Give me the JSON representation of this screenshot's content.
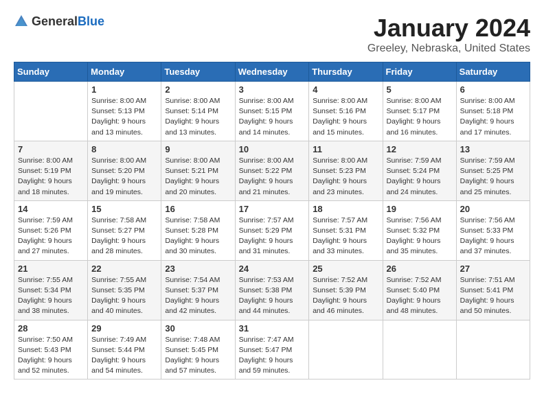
{
  "logo": {
    "general": "General",
    "blue": "Blue"
  },
  "title": "January 2024",
  "location": "Greeley, Nebraska, United States",
  "days_header": [
    "Sunday",
    "Monday",
    "Tuesday",
    "Wednesday",
    "Thursday",
    "Friday",
    "Saturday"
  ],
  "weeks": [
    [
      {
        "day": "",
        "sunrise": "",
        "sunset": "",
        "daylight": ""
      },
      {
        "day": "1",
        "sunrise": "Sunrise: 8:00 AM",
        "sunset": "Sunset: 5:13 PM",
        "daylight": "Daylight: 9 hours and 13 minutes."
      },
      {
        "day": "2",
        "sunrise": "Sunrise: 8:00 AM",
        "sunset": "Sunset: 5:14 PM",
        "daylight": "Daylight: 9 hours and 13 minutes."
      },
      {
        "day": "3",
        "sunrise": "Sunrise: 8:00 AM",
        "sunset": "Sunset: 5:15 PM",
        "daylight": "Daylight: 9 hours and 14 minutes."
      },
      {
        "day": "4",
        "sunrise": "Sunrise: 8:00 AM",
        "sunset": "Sunset: 5:16 PM",
        "daylight": "Daylight: 9 hours and 15 minutes."
      },
      {
        "day": "5",
        "sunrise": "Sunrise: 8:00 AM",
        "sunset": "Sunset: 5:17 PM",
        "daylight": "Daylight: 9 hours and 16 minutes."
      },
      {
        "day": "6",
        "sunrise": "Sunrise: 8:00 AM",
        "sunset": "Sunset: 5:18 PM",
        "daylight": "Daylight: 9 hours and 17 minutes."
      }
    ],
    [
      {
        "day": "7",
        "sunrise": "Sunrise: 8:00 AM",
        "sunset": "Sunset: 5:19 PM",
        "daylight": "Daylight: 9 hours and 18 minutes."
      },
      {
        "day": "8",
        "sunrise": "Sunrise: 8:00 AM",
        "sunset": "Sunset: 5:20 PM",
        "daylight": "Daylight: 9 hours and 19 minutes."
      },
      {
        "day": "9",
        "sunrise": "Sunrise: 8:00 AM",
        "sunset": "Sunset: 5:21 PM",
        "daylight": "Daylight: 9 hours and 20 minutes."
      },
      {
        "day": "10",
        "sunrise": "Sunrise: 8:00 AM",
        "sunset": "Sunset: 5:22 PM",
        "daylight": "Daylight: 9 hours and 21 minutes."
      },
      {
        "day": "11",
        "sunrise": "Sunrise: 8:00 AM",
        "sunset": "Sunset: 5:23 PM",
        "daylight": "Daylight: 9 hours and 23 minutes."
      },
      {
        "day": "12",
        "sunrise": "Sunrise: 7:59 AM",
        "sunset": "Sunset: 5:24 PM",
        "daylight": "Daylight: 9 hours and 24 minutes."
      },
      {
        "day": "13",
        "sunrise": "Sunrise: 7:59 AM",
        "sunset": "Sunset: 5:25 PM",
        "daylight": "Daylight: 9 hours and 25 minutes."
      }
    ],
    [
      {
        "day": "14",
        "sunrise": "Sunrise: 7:59 AM",
        "sunset": "Sunset: 5:26 PM",
        "daylight": "Daylight: 9 hours and 27 minutes."
      },
      {
        "day": "15",
        "sunrise": "Sunrise: 7:58 AM",
        "sunset": "Sunset: 5:27 PM",
        "daylight": "Daylight: 9 hours and 28 minutes."
      },
      {
        "day": "16",
        "sunrise": "Sunrise: 7:58 AM",
        "sunset": "Sunset: 5:28 PM",
        "daylight": "Daylight: 9 hours and 30 minutes."
      },
      {
        "day": "17",
        "sunrise": "Sunrise: 7:57 AM",
        "sunset": "Sunset: 5:29 PM",
        "daylight": "Daylight: 9 hours and 31 minutes."
      },
      {
        "day": "18",
        "sunrise": "Sunrise: 7:57 AM",
        "sunset": "Sunset: 5:31 PM",
        "daylight": "Daylight: 9 hours and 33 minutes."
      },
      {
        "day": "19",
        "sunrise": "Sunrise: 7:56 AM",
        "sunset": "Sunset: 5:32 PM",
        "daylight": "Daylight: 9 hours and 35 minutes."
      },
      {
        "day": "20",
        "sunrise": "Sunrise: 7:56 AM",
        "sunset": "Sunset: 5:33 PM",
        "daylight": "Daylight: 9 hours and 37 minutes."
      }
    ],
    [
      {
        "day": "21",
        "sunrise": "Sunrise: 7:55 AM",
        "sunset": "Sunset: 5:34 PM",
        "daylight": "Daylight: 9 hours and 38 minutes."
      },
      {
        "day": "22",
        "sunrise": "Sunrise: 7:55 AM",
        "sunset": "Sunset: 5:35 PM",
        "daylight": "Daylight: 9 hours and 40 minutes."
      },
      {
        "day": "23",
        "sunrise": "Sunrise: 7:54 AM",
        "sunset": "Sunset: 5:37 PM",
        "daylight": "Daylight: 9 hours and 42 minutes."
      },
      {
        "day": "24",
        "sunrise": "Sunrise: 7:53 AM",
        "sunset": "Sunset: 5:38 PM",
        "daylight": "Daylight: 9 hours and 44 minutes."
      },
      {
        "day": "25",
        "sunrise": "Sunrise: 7:52 AM",
        "sunset": "Sunset: 5:39 PM",
        "daylight": "Daylight: 9 hours and 46 minutes."
      },
      {
        "day": "26",
        "sunrise": "Sunrise: 7:52 AM",
        "sunset": "Sunset: 5:40 PM",
        "daylight": "Daylight: 9 hours and 48 minutes."
      },
      {
        "day": "27",
        "sunrise": "Sunrise: 7:51 AM",
        "sunset": "Sunset: 5:41 PM",
        "daylight": "Daylight: 9 hours and 50 minutes."
      }
    ],
    [
      {
        "day": "28",
        "sunrise": "Sunrise: 7:50 AM",
        "sunset": "Sunset: 5:43 PM",
        "daylight": "Daylight: 9 hours and 52 minutes."
      },
      {
        "day": "29",
        "sunrise": "Sunrise: 7:49 AM",
        "sunset": "Sunset: 5:44 PM",
        "daylight": "Daylight: 9 hours and 54 minutes."
      },
      {
        "day": "30",
        "sunrise": "Sunrise: 7:48 AM",
        "sunset": "Sunset: 5:45 PM",
        "daylight": "Daylight: 9 hours and 57 minutes."
      },
      {
        "day": "31",
        "sunrise": "Sunrise: 7:47 AM",
        "sunset": "Sunset: 5:47 PM",
        "daylight": "Daylight: 9 hours and 59 minutes."
      },
      {
        "day": "",
        "sunrise": "",
        "sunset": "",
        "daylight": ""
      },
      {
        "day": "",
        "sunrise": "",
        "sunset": "",
        "daylight": ""
      },
      {
        "day": "",
        "sunrise": "",
        "sunset": "",
        "daylight": ""
      }
    ]
  ]
}
